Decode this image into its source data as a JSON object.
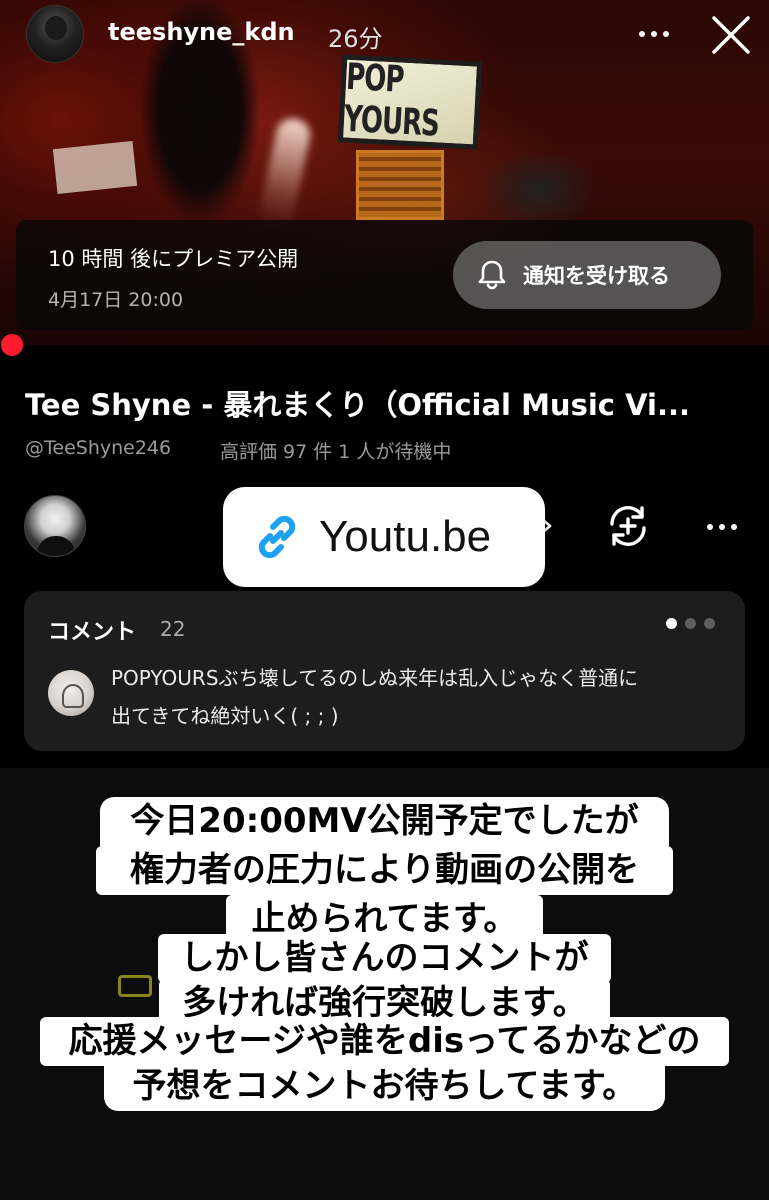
{
  "story": {
    "username": "teeshyne_kdn",
    "time": "26分"
  },
  "video": {
    "scene_text": "POP YOURS",
    "premiere_countdown": "10 時間 後にプレミア公開",
    "premiere_datetime": "4月17日 20:00",
    "notify_button": "通知を受け取る",
    "title": "Tee Shyne - 暴れまくり（Official Music Vi...",
    "channel_handle": "@TeeShyne246",
    "meta": "高評価 97 件  1 人が待機中"
  },
  "link_sticker": {
    "label": "Youtu.be"
  },
  "comments": {
    "title": "コメント",
    "count": "22",
    "pager": {
      "total": 3,
      "active": 1
    },
    "first_comment_line1": "POPYOURSぶち壊してるのしぬ来年は乱入じゃなく普通に",
    "first_comment_line2": "出てきてね絶対いく( ; ; )"
  },
  "caption": {
    "lines": [
      "今日20:00MV公開予定でしたが",
      "権力者の圧力により動画の公開を",
      "止められてます。",
      "しかし皆さんのコメントが",
      "多ければ強行突破します。",
      "応援メッセージや誰をdisってるかなどの",
      "予想をコメントお待ちしてます。"
    ]
  },
  "colors": {
    "progress_dot": "#ff1b2d",
    "link_icon": "#1da1f2",
    "comment_card": "#1d1d1d"
  },
  "icons": [
    "more-icon",
    "close-icon",
    "bell-icon",
    "link-icon",
    "chevron-right-icon",
    "remix-icon"
  ]
}
